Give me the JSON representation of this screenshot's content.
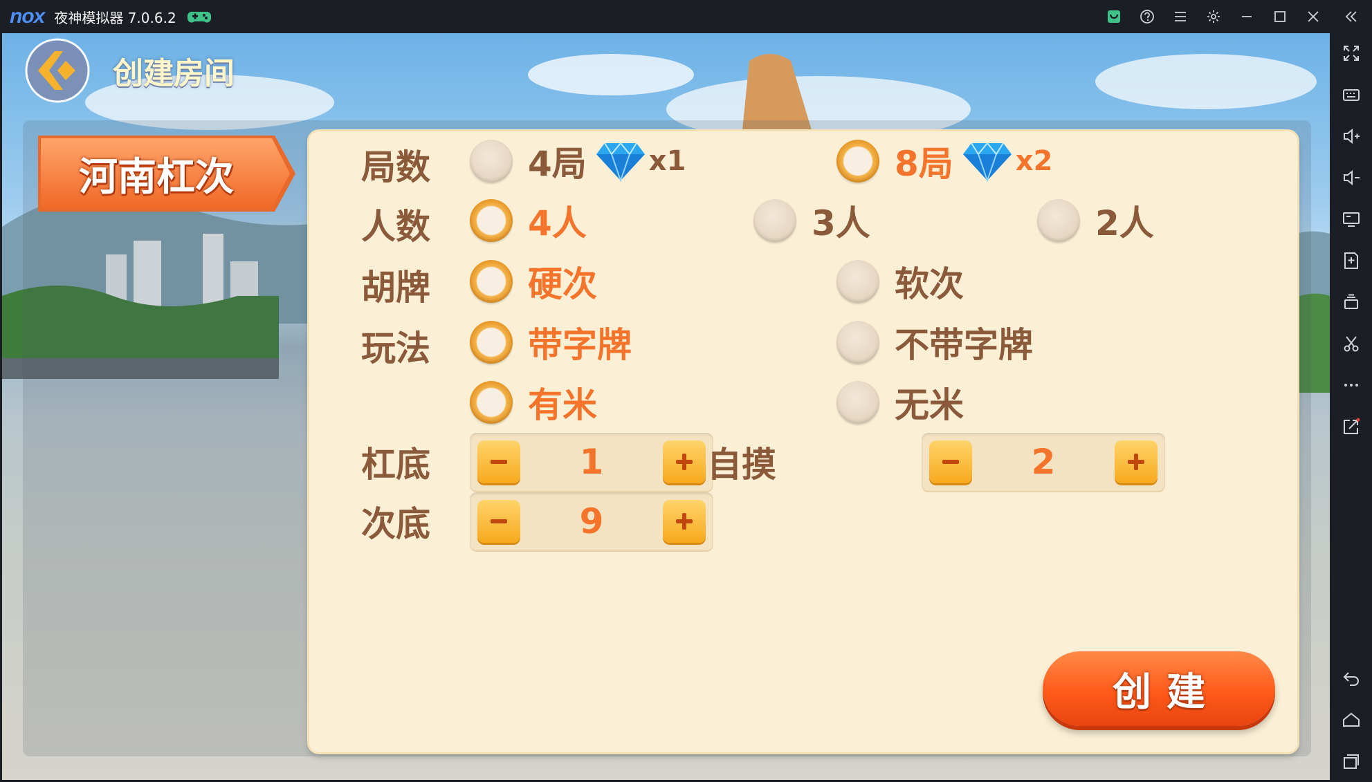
{
  "titlebar": {
    "logo": "nox",
    "app_title": "夜神模拟器 7.0.6.2"
  },
  "header": {
    "title": "创建房间"
  },
  "mode_tab": {
    "label": "河南杠次"
  },
  "options": {
    "rounds": {
      "label": "局数",
      "choices": [
        {
          "text": "4局",
          "mult": "x1",
          "selected": false
        },
        {
          "text": "8局",
          "mult": "x2",
          "selected": true
        }
      ]
    },
    "players": {
      "label": "人数",
      "choices": [
        {
          "text": "4人",
          "selected": true
        },
        {
          "text": "3人",
          "selected": false
        },
        {
          "text": "2人",
          "selected": false
        }
      ]
    },
    "hupai": {
      "label": "胡牌",
      "choices": [
        {
          "text": "硬次",
          "selected": true
        },
        {
          "text": "软次",
          "selected": false
        }
      ]
    },
    "play": {
      "label": "玩法",
      "choices": [
        {
          "text": "带字牌",
          "selected": true
        },
        {
          "text": "不带字牌",
          "selected": false
        },
        {
          "text": "有米",
          "selected": true
        },
        {
          "text": "无米",
          "selected": false
        }
      ]
    }
  },
  "steppers": {
    "gangdi": {
      "label": "杠底",
      "value": "1"
    },
    "zimo": {
      "label": "自摸",
      "value": "2"
    },
    "cidi": {
      "label": "次底",
      "value": "9"
    }
  },
  "create_button": {
    "label": "创建"
  },
  "colors": {
    "accent_orange": "#f4742c",
    "label_brown": "#8a5a3a",
    "panel_bg": "#fbf0d6",
    "emulator_chrome": "#1c1e26"
  },
  "icons": {
    "titlebar": [
      "gamepad-icon",
      "store-icon",
      "help-icon",
      "menu-icon",
      "settings-icon",
      "minimize-icon",
      "maximize-icon",
      "close-icon",
      "collapse-icon"
    ],
    "sidebar": [
      "fullscreen-icon",
      "keyboard-icon",
      "volume-up-icon",
      "volume-down-icon",
      "screen-icon",
      "apk-install-icon",
      "multi-instance-icon",
      "scissors-icon",
      "more-icon",
      "share-icon",
      "back-icon",
      "home-icon",
      "recent-apps-icon"
    ]
  }
}
